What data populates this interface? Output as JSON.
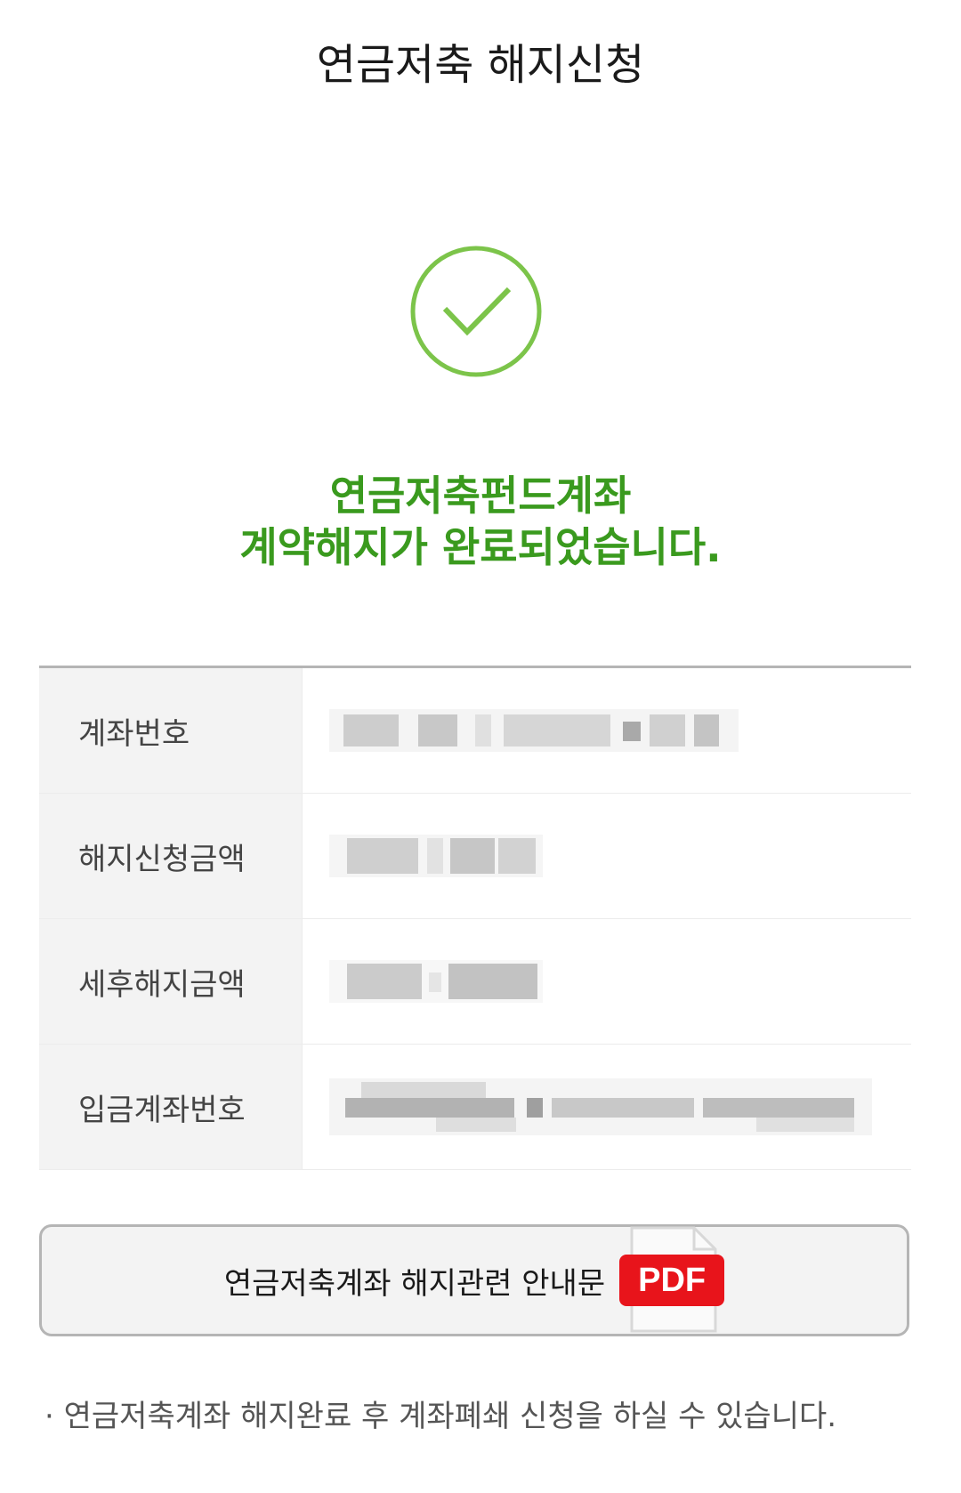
{
  "header": {
    "title": "연금저축 해지신청"
  },
  "result": {
    "icon": "checkmark-circle-icon",
    "accent_color": "#3a9a1e",
    "line1": "연금저축펀드계좌",
    "line2": "계약해지가 완료되었습니다."
  },
  "details": {
    "rows": [
      {
        "label": "계좌번호"
      },
      {
        "label": "해지신청금액"
      },
      {
        "label": "세후해지금액"
      },
      {
        "label": "입금계좌번호"
      }
    ]
  },
  "guide_button": {
    "label": "연금저축계좌 해지관련 안내문",
    "badge": "PDF",
    "icon": "pdf-file-icon"
  },
  "notice": {
    "bullet": "·",
    "text": "연금저축계좌 해지완료 후 계좌폐쇄 신청을 하실 수 있습니다."
  }
}
